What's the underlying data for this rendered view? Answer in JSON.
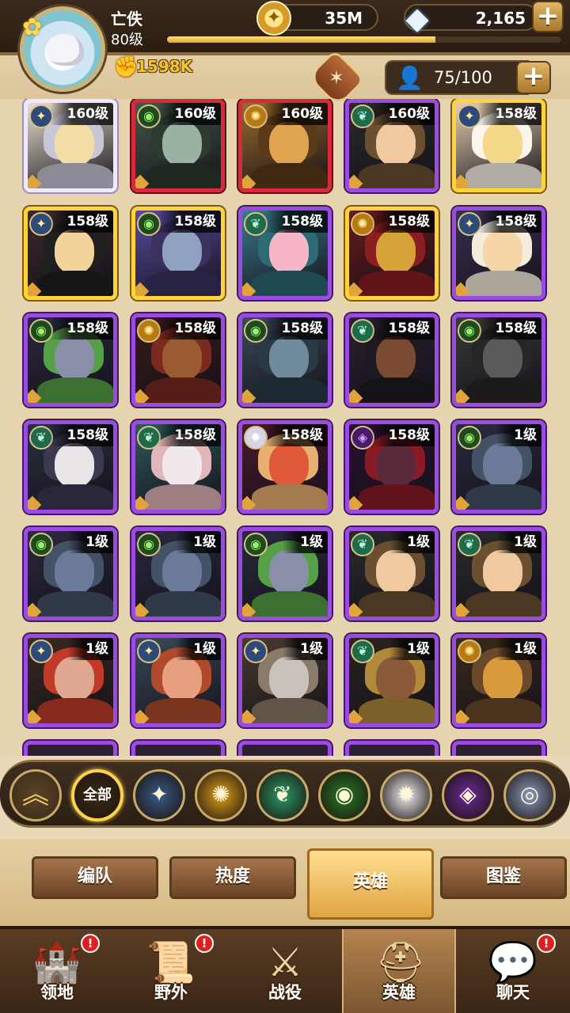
{
  "player": {
    "name": "亡佚",
    "level": "80级",
    "xp_fraction": 0.68,
    "power": "1598K"
  },
  "currency": {
    "gold": "35M",
    "gems": "2,165"
  },
  "heroes_count": "75/100",
  "colors": {
    "purple_frame": "#9c4be0",
    "gold_frame": "#ffd23e",
    "red_frame": "#d42c3c",
    "white_frame": "#f0e8ff"
  },
  "hero_grid": {
    "rows": [
      [
        {
          "level": "160级",
          "frame": "white",
          "faction": "star",
          "palette": [
            "#e8e0d0",
            "#f3dca5",
            "#c9c7d6"
          ]
        },
        {
          "level": "160级",
          "frame": "red",
          "faction": "eye",
          "palette": [
            "#44584a",
            "#9ab2a1",
            "#2c3a30"
          ]
        },
        {
          "level": "160级",
          "frame": "red",
          "faction": "sun",
          "palette": [
            "#9a6a2a",
            "#e0a350",
            "#5a3a1a"
          ]
        },
        {
          "level": "160级",
          "frame": "purple",
          "faction": "leaf",
          "palette": [
            "#2a2a2a",
            "#f0c9a0",
            "#6a5030"
          ]
        },
        {
          "level": "158级",
          "frame": "gold",
          "faction": "star",
          "palette": [
            "#e7cfb2",
            "#f6d88a",
            "#fbf5ea"
          ]
        }
      ],
      [
        {
          "level": "158级",
          "frame": "gold",
          "faction": "star",
          "palette": [
            "#3a2a2a",
            "#f1d39b",
            "#202020"
          ]
        },
        {
          "level": "158级",
          "frame": "gold",
          "faction": "eye",
          "palette": [
            "#5a4ca0",
            "#8fa0c0",
            "#3b305e"
          ]
        },
        {
          "level": "158级",
          "frame": "purple",
          "faction": "leaf",
          "palette": [
            "#3a7a8a",
            "#f7b6c6",
            "#2c6a74"
          ]
        },
        {
          "level": "158级",
          "frame": "gold",
          "faction": "sun",
          "palette": [
            "#6a1a1a",
            "#d6a23a",
            "#8a1e20"
          ]
        },
        {
          "level": "158级",
          "frame": "purple",
          "faction": "star",
          "palette": [
            "#3a3050",
            "#f6d6a6",
            "#f4ecdc"
          ]
        }
      ],
      [
        {
          "level": "158级",
          "frame": "purple",
          "faction": "eye",
          "palette": [
            "#2a2a40",
            "#8a8fa8",
            "#55a046"
          ]
        },
        {
          "level": "158级",
          "frame": "purple",
          "faction": "sun",
          "palette": [
            "#3a1a1a",
            "#9a5a32",
            "#7a2a20"
          ]
        },
        {
          "level": "158级",
          "frame": "purple",
          "faction": "eye",
          "palette": [
            "#3a4a5a",
            "#6f8a9a",
            "#2a3a44"
          ]
        },
        {
          "level": "158级",
          "frame": "purple",
          "faction": "leaf",
          "palette": [
            "#2a2030",
            "#7a4a32",
            "#1e1a22"
          ]
        },
        {
          "level": "158级",
          "frame": "purple",
          "faction": "eye",
          "palette": [
            "#3a3a3a",
            "#5a5a5a",
            "#262626"
          ]
        }
      ],
      [
        {
          "level": "158级",
          "frame": "purple",
          "faction": "leaf",
          "palette": [
            "#2a3040",
            "#e9e4e8",
            "#3c3850"
          ]
        },
        {
          "level": "158级",
          "frame": "purple",
          "faction": "leaf",
          "palette": [
            "#2e5a5a",
            "#f0e8ea",
            "#e2b6b8"
          ]
        },
        {
          "level": "158级",
          "frame": "purple",
          "faction": "light",
          "palette": [
            "#4a1a2a",
            "#e05a3a",
            "#e8b070"
          ]
        },
        {
          "level": "158级",
          "frame": "purple",
          "faction": "void",
          "palette": [
            "#2a1030",
            "#5a2a3a",
            "#8a1a26"
          ]
        },
        {
          "level": "1级",
          "frame": "purple",
          "faction": "eye",
          "palette": [
            "#2a2a40",
            "#6a7a98",
            "#445266"
          ]
        }
      ],
      [
        {
          "level": "1级",
          "frame": "purple",
          "faction": "eye",
          "palette": [
            "#2a2a40",
            "#6a7a98",
            "#445266"
          ]
        },
        {
          "level": "1级",
          "frame": "purple",
          "faction": "eye",
          "palette": [
            "#2a2a40",
            "#6a7a98",
            "#445266"
          ]
        },
        {
          "level": "1级",
          "frame": "purple",
          "faction": "eye",
          "palette": [
            "#2a2a40",
            "#8a8fa8",
            "#55a046"
          ]
        },
        {
          "level": "1级",
          "frame": "purple",
          "faction": "leaf",
          "palette": [
            "#2a2a2a",
            "#f0c9a0",
            "#6a5030"
          ]
        },
        {
          "level": "1级",
          "frame": "purple",
          "faction": "leaf",
          "palette": [
            "#2a2a2a",
            "#f0c9a0",
            "#6a5030"
          ]
        }
      ],
      [
        {
          "level": "1级",
          "frame": "purple",
          "faction": "star",
          "palette": [
            "#3a2a20",
            "#e0a890",
            "#c23a2a"
          ]
        },
        {
          "level": "1级",
          "frame": "purple",
          "faction": "star",
          "palette": [
            "#3a4a5a",
            "#e6a080",
            "#b04a2a"
          ]
        },
        {
          "level": "1级",
          "frame": "purple",
          "faction": "star",
          "palette": [
            "#4a3a30",
            "#c8c2ba",
            "#8a7a6a"
          ]
        },
        {
          "level": "1级",
          "frame": "purple",
          "faction": "leaf",
          "palette": [
            "#2a2420",
            "#8a5a3a",
            "#b08a3a"
          ]
        },
        {
          "level": "1级",
          "frame": "purple",
          "faction": "sun",
          "palette": [
            "#3a2a1a",
            "#d89a3a",
            "#6a4a2a"
          ]
        }
      ]
    ]
  },
  "faction_filters": [
    {
      "id": "collapse",
      "icon": "chevron-up-icon"
    },
    {
      "id": "all",
      "label": "全部"
    },
    {
      "id": "lightbearer",
      "icon": "compass-star-icon",
      "color": "#3a5a8a"
    },
    {
      "id": "mauler",
      "icon": "sun-gear-icon",
      "color": "#e0a020"
    },
    {
      "id": "wilder",
      "icon": "leaf-icon",
      "color": "#2a9a6a"
    },
    {
      "id": "graveborn",
      "icon": "eye-icon",
      "color": "#2a7a2a"
    },
    {
      "id": "celestial",
      "icon": "radiant-star-icon",
      "color": "#f0eef8"
    },
    {
      "id": "hypogean",
      "icon": "void-diamond-icon",
      "color": "#6a2a9a"
    },
    {
      "id": "dimensional",
      "icon": "shield-ring-icon",
      "color": "#8a9ac0"
    }
  ],
  "section_tabs": [
    {
      "label": "编队",
      "active": false
    },
    {
      "label": "热度",
      "active": false
    },
    {
      "label": "英雄",
      "active": true
    },
    {
      "label": "图鉴",
      "active": false
    }
  ],
  "bottom_nav": [
    {
      "label": "领地",
      "icon": "castle-icon",
      "badge": "!",
      "active": false
    },
    {
      "label": "野外",
      "icon": "scroll-map-icon",
      "badge": "!",
      "active": false
    },
    {
      "label": "战役",
      "icon": "sword-emblem-icon",
      "badge": "",
      "active": false
    },
    {
      "label": "英雄",
      "icon": "helmet-icon",
      "badge": "",
      "active": true
    },
    {
      "label": "聊天",
      "icon": "chat-icon",
      "badge": "!",
      "active": false
    }
  ]
}
